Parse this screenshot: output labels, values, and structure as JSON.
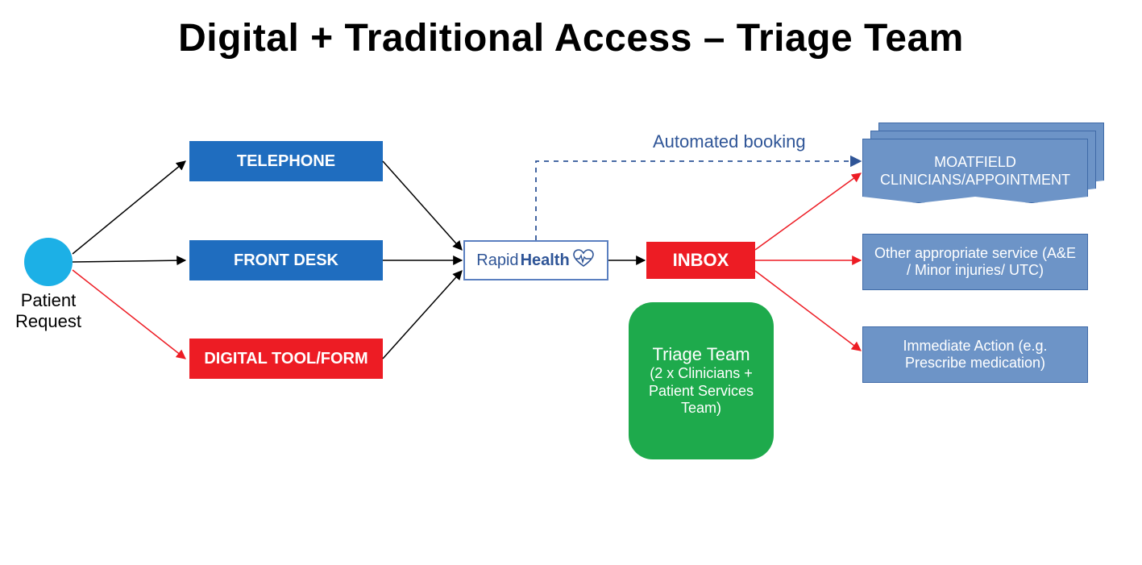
{
  "title": "Digital + Traditional Access – Triage Team",
  "patient": {
    "label": "Patient\nRequest"
  },
  "channels": {
    "telephone": "TELEPHONE",
    "front_desk": "FRONT DESK",
    "digital_tool": "DIGITAL TOOL/FORM"
  },
  "rapidhealth": {
    "thin": "Rapid",
    "bold": "Health"
  },
  "inbox": "INBOX",
  "triage_team": {
    "title": "Triage Team",
    "subtitle": "(2 x Clinicians + Patient Services Team)"
  },
  "auto_booking": "Automated booking",
  "outcomes": {
    "clinicians": "MOATFIELD CLINICIANS/APPOINTMENT",
    "other_service": "Other appropriate service (A&E / Minor injuries/ UTC)",
    "immediate": "Immediate Action (e.g. Prescribe medication)"
  }
}
